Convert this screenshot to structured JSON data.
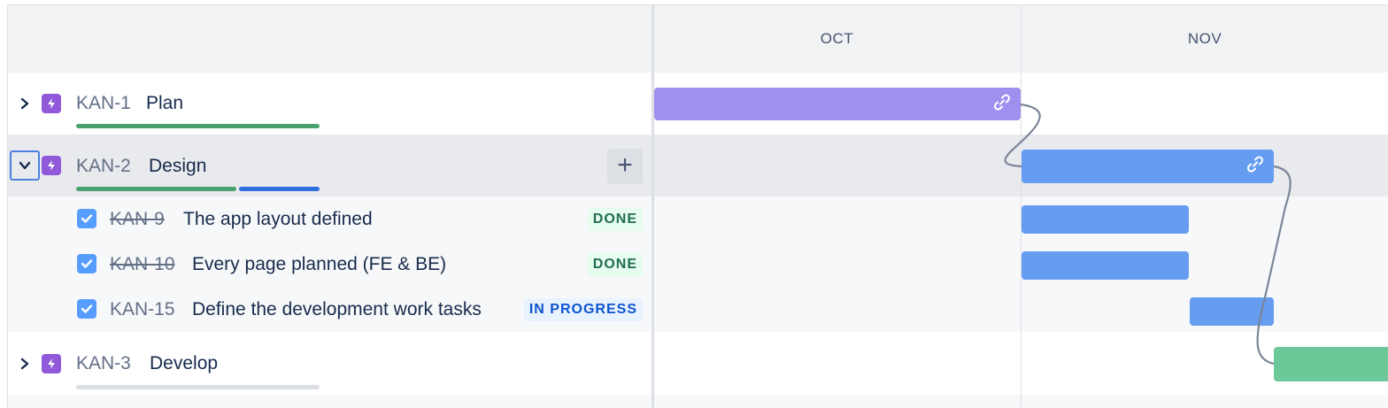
{
  "timeline": {
    "months": [
      "OCT",
      "NOV"
    ]
  },
  "issues": [
    {
      "key": "KAN-1",
      "summary": "Plan",
      "type": "epic-icon",
      "expanded": false,
      "progress": {
        "done": 1.0,
        "in_progress": 0.0
      },
      "bar_color": "#9f8fef"
    },
    {
      "key": "KAN-2",
      "summary": "Design",
      "type": "epic-icon",
      "expanded": true,
      "progress": {
        "done": 0.66,
        "in_progress": 0.34
      },
      "bar_color": "#669df1",
      "children": [
        {
          "key": "KAN-9",
          "summary": "The app layout defined",
          "status": "DONE"
        },
        {
          "key": "KAN-10",
          "summary": "Every page planned (FE & BE)",
          "status": "DONE"
        },
        {
          "key": "KAN-15",
          "summary": "Define the development work tasks",
          "status": "IN PROGRESS"
        }
      ]
    },
    {
      "key": "KAN-3",
      "summary": "Develop",
      "type": "epic-icon",
      "expanded": false,
      "progress": {
        "done": 0.0,
        "in_progress": 0.0
      },
      "bar_color": "#6cc799"
    }
  ],
  "colors": {
    "done_progress": "#4ba26f",
    "in_progress": "#2f6fde",
    "todo_progress": "#dcdfe4",
    "epic_icon_bg": "#8f59d9",
    "task_icon_bg": "#579dff",
    "dependency_line": "#7a8599"
  },
  "icons": {
    "expand": "chevron-right-icon",
    "collapse": "chevron-down-icon",
    "epic": "lightning-icon",
    "task": "checkbox-icon",
    "link": "link-icon",
    "add": "plus-icon"
  }
}
